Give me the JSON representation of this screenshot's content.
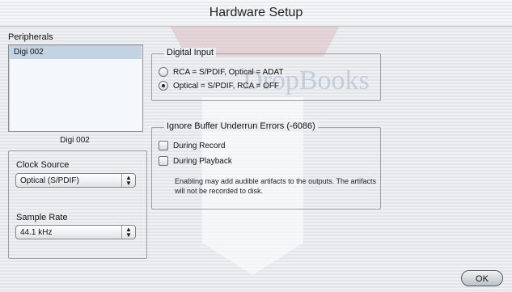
{
  "window": {
    "title": "Hardware Setup"
  },
  "watermark": {
    "text": "DropBooks"
  },
  "peripherals": {
    "label": "Peripherals",
    "items": [
      "Digi 002"
    ],
    "selected_name": "Digi 002"
  },
  "clock_source": {
    "label": "Clock Source",
    "value": "Optical (S/PDIF)"
  },
  "sample_rate": {
    "label": "Sample Rate",
    "value": "44.1 kHz"
  },
  "digital_input": {
    "label": "Digital Input",
    "options": [
      {
        "label": "RCA = S/PDIF, Optical = ADAT",
        "selected": false
      },
      {
        "label": "Optical = S/PDIF, RCA = OFF",
        "selected": true
      }
    ]
  },
  "buffer_errors": {
    "label": "Ignore Buffer Underrun Errors (-6086)",
    "options": [
      {
        "label": "During Record",
        "checked": false
      },
      {
        "label": "During Playback",
        "checked": false
      }
    ],
    "note": "Enabling may add audible artifacts to the outputs. The artifacts will not be recorded to disk."
  },
  "ok_button": {
    "label": "OK"
  }
}
